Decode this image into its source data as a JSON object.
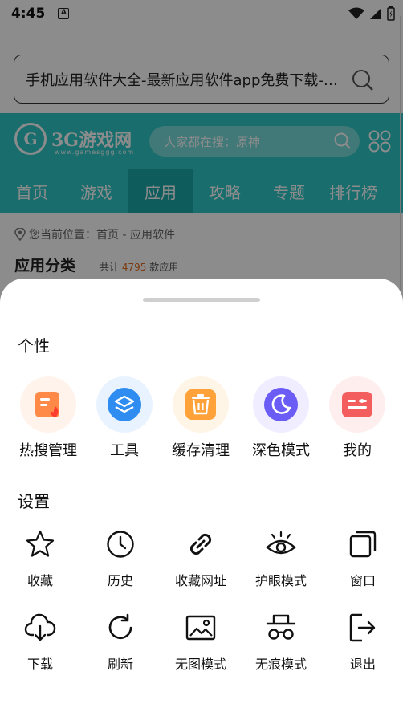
{
  "status_bar": {
    "time": "4:45",
    "notif_letter": "A"
  },
  "browser": {
    "url_text": "手机应用软件大全-最新应用软件app免费下载-3..."
  },
  "site": {
    "logo_text": "3G游戏网",
    "logo_sub": "www.gamesggg.com",
    "search_placeholder": "大家都在搜：原神",
    "nav": [
      "首页",
      "游戏",
      "应用",
      "攻略",
      "专题",
      "排行榜"
    ],
    "nav_active": "应用",
    "breadcrumb": "您当前位置：首页 - 应用软件",
    "category_title": "应用分类",
    "count_prefix": "共计",
    "count_value": "4795",
    "count_suffix": "款应用"
  },
  "sheet": {
    "section_personal": "个性",
    "features": [
      {
        "label": "热搜管理",
        "icon": "hot-search-icon",
        "bg": "#fff3ec",
        "color": "#ff7a3d"
      },
      {
        "label": "工具",
        "icon": "tools-layers-icon",
        "bg": "#e9f3ff",
        "color": "#2f8cf0"
      },
      {
        "label": "缓存清理",
        "icon": "trash-can-icon",
        "bg": "#fff5e6",
        "color": "#ff9f2e"
      },
      {
        "label": "深色模式",
        "icon": "moon-icon",
        "bg": "#efedff",
        "color": "#6b5cf5"
      },
      {
        "label": "我的",
        "icon": "profile-card-icon",
        "bg": "#ffeeee",
        "color": "#f25a5a"
      }
    ],
    "section_settings": "设置",
    "tools": [
      {
        "label": "收藏",
        "icon": "star-icon"
      },
      {
        "label": "历史",
        "icon": "clock-icon"
      },
      {
        "label": "收藏网址",
        "icon": "link-icon"
      },
      {
        "label": "护眼模式",
        "icon": "eye-icon"
      },
      {
        "label": "窗口",
        "icon": "windows-icon"
      },
      {
        "label": "下载",
        "icon": "cloud-download-icon"
      },
      {
        "label": "刷新",
        "icon": "refresh-icon"
      },
      {
        "label": "无图模式",
        "icon": "image-icon"
      },
      {
        "label": "无痕模式",
        "icon": "incognito-icon"
      },
      {
        "label": "退出",
        "icon": "exit-icon"
      }
    ]
  }
}
